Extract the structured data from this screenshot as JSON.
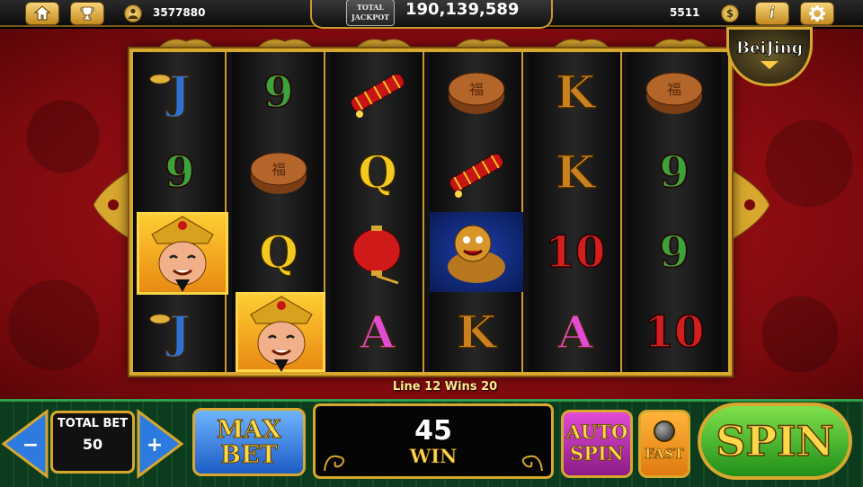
{
  "topbar": {
    "player_coins": "3577880",
    "jackpot_logo": "TOTAL JACKPOT",
    "jackpot_value": "190,139,589",
    "balance": "5511",
    "coin_symbol": "$",
    "info_symbol": "i"
  },
  "game": {
    "theme_badge": "BeiJing",
    "line_message": "Line 12 Wins 20",
    "reels": [
      [
        "J",
        "9",
        "God of Wealth",
        "J"
      ],
      [
        "9",
        "Mooncake",
        "Q",
        "God of Wealth"
      ],
      [
        "Firecracker",
        "Q",
        "Lantern",
        "A"
      ],
      [
        "Mooncake",
        "Firecracker",
        "Lion",
        "K"
      ],
      [
        "K",
        "K",
        "10",
        "A"
      ],
      [
        "Mooncake",
        "9",
        "9",
        "10"
      ]
    ]
  },
  "console": {
    "total_bet_label": "TOTAL BET",
    "total_bet_value": "50",
    "minus": "−",
    "plus": "+",
    "max_bet_label": "MAX BET",
    "win_value": "45",
    "win_label": "WIN",
    "auto_spin_label": "AUTO SPIN",
    "fast_label": "FAST",
    "spin_label": "SPIN"
  },
  "colors": {
    "gold": "#d7a72e",
    "red_bg": "#9e1016",
    "console_green": "#0f4321"
  }
}
